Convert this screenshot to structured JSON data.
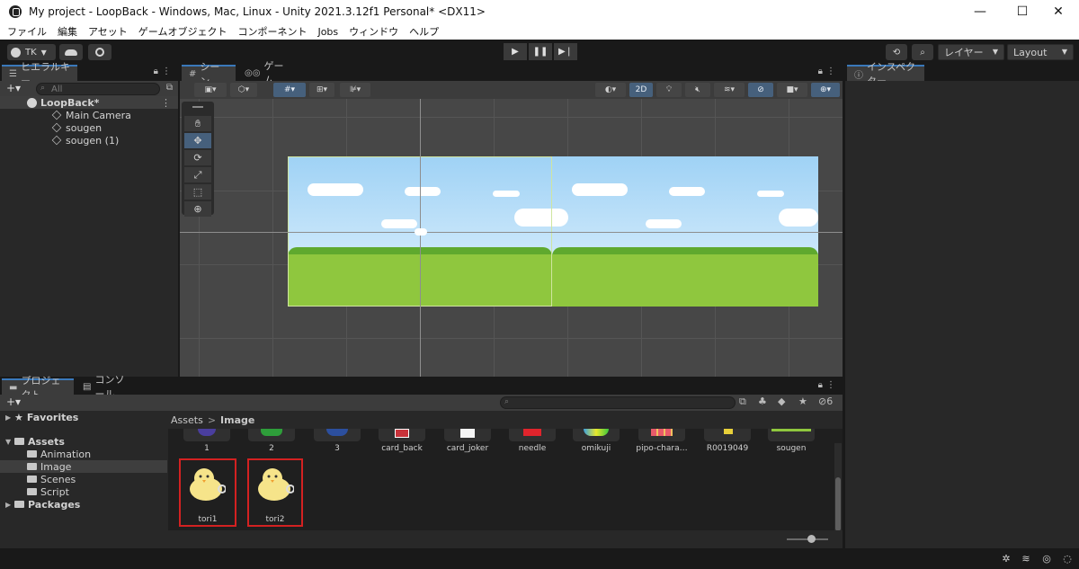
{
  "window": {
    "title": "My project - LoopBack - Windows, Mac, Linux - Unity 2021.3.12f1 Personal* <DX11>",
    "minimize": "—",
    "maximize": "☐",
    "close": "✕"
  },
  "menu": [
    "ファイル",
    "編集",
    "アセット",
    "ゲームオブジェクト",
    "コンポーネント",
    "Jobs",
    "ウィンドウ",
    "ヘルプ"
  ],
  "toolbar": {
    "account": "TK",
    "layers": "レイヤー",
    "layout": "Layout"
  },
  "hierarchy": {
    "tab": "ヒエラルキー",
    "search_placeholder": "All",
    "scene": "LoopBack*",
    "objects": [
      "Main Camera",
      "sougen",
      "sougen (1)"
    ]
  },
  "scene": {
    "tab_scene": "シーン",
    "tab_game": "ゲーム",
    "mode_2d": "2D"
  },
  "inspector": {
    "tab": "インスペクター"
  },
  "project": {
    "tab_project": "プロジェクト",
    "tab_console": "コンソール",
    "hidden_count": "6",
    "breadcrumb": [
      "Assets",
      "Image"
    ],
    "favorites": "Favorites",
    "assets_root": "Assets",
    "folders": [
      "Animation",
      "Image",
      "Scenes",
      "Script"
    ],
    "packages": "Packages",
    "assets_row1": [
      "1",
      "2",
      "3",
      "card_back",
      "card_joker",
      "needle",
      "omikuji",
      "pipo-chara…",
      "R0019049",
      "sougen"
    ],
    "assets_row2": [
      "tori1",
      "tori2"
    ]
  },
  "colors": {
    "accent": "#3a79bb",
    "selection_highlight": "#d32121"
  }
}
